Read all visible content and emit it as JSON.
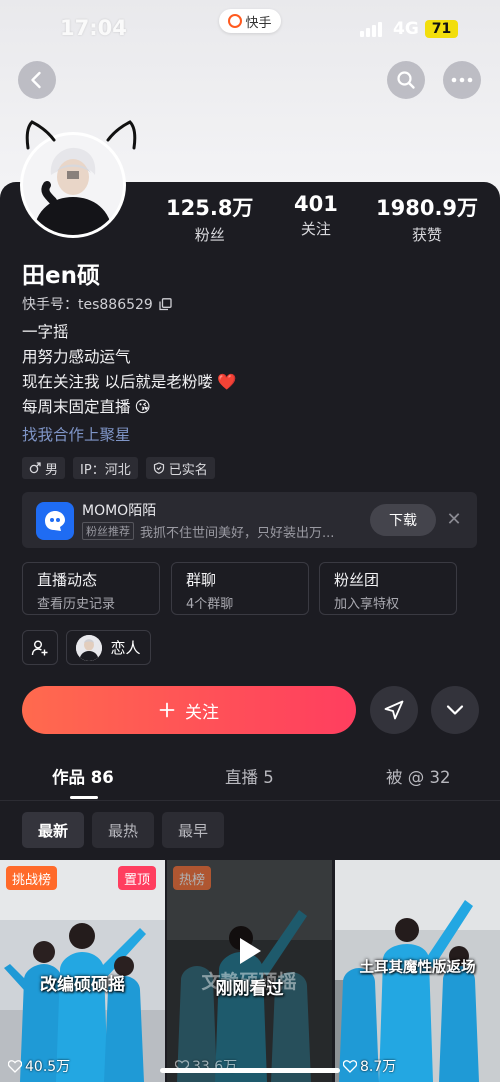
{
  "status_bar": {
    "time": "17:04",
    "app_name": "快手",
    "network": "4G",
    "battery": "71"
  },
  "profile": {
    "username": "田en硕",
    "id_label": "快手号：",
    "id_value": "tes886529",
    "stats": [
      {
        "value": "125.8万",
        "label": "粉丝"
      },
      {
        "value": "401",
        "label": "关注"
      },
      {
        "value": "1980.9万",
        "label": "获赞"
      }
    ],
    "bio": [
      "一字摇",
      "用努力感动运气",
      "现在关注我 以后就是老粉喽",
      "每周末固定直播"
    ],
    "bio_emoji": {
      "heart": "❤️",
      "kiss": "😘"
    },
    "cooperate_link": "找我合作上聚星",
    "tags": [
      "男",
      "IP：河北",
      "已实名"
    ]
  },
  "ad": {
    "title": "MOMO陌陌",
    "badge": "粉丝推荐",
    "description": "我抓不住世间美好，只好装出万...",
    "download_label": "下载",
    "close_glyph": "✕"
  },
  "features": [
    {
      "title": "直播动态",
      "subtitle": "查看历史记录"
    },
    {
      "title": "群聊",
      "subtitle": "4个群聊"
    },
    {
      "title": "粉丝团",
      "subtitle": "加入享特权"
    }
  ],
  "lover_label": "恋人",
  "follow_label": "关注",
  "tabs": [
    {
      "label": "作品 86"
    },
    {
      "label": "直播 5"
    },
    {
      "label": "被 @ 32"
    }
  ],
  "sort_options": [
    "最新",
    "最热",
    "最早"
  ],
  "videos": [
    {
      "badge_left": "挑战榜",
      "badge_right": "置顶",
      "caption": "改编硕硕摇",
      "likes": "40.5万"
    },
    {
      "badge_left": "热榜",
      "caption": "刚刚看过",
      "overlay_title": "文静硕硕摇",
      "likes": "33.6万"
    },
    {
      "caption": "土耳其魔性版返场",
      "likes": "8.7万"
    }
  ],
  "colors": {
    "accent_follow": "#ff4a5a",
    "link": "#7f95c7",
    "battery": "#f2de0c",
    "challenge_badge": "#ff6a2a",
    "pinned_badge": "#ff3e5f"
  },
  "icons": [
    "back-arrow-icon",
    "search-icon",
    "more-icon",
    "copy-icon",
    "male-icon",
    "shield-icon",
    "add-friend-icon",
    "plus-icon",
    "share-icon",
    "chevron-down-icon",
    "play-icon",
    "heart-icon"
  ]
}
